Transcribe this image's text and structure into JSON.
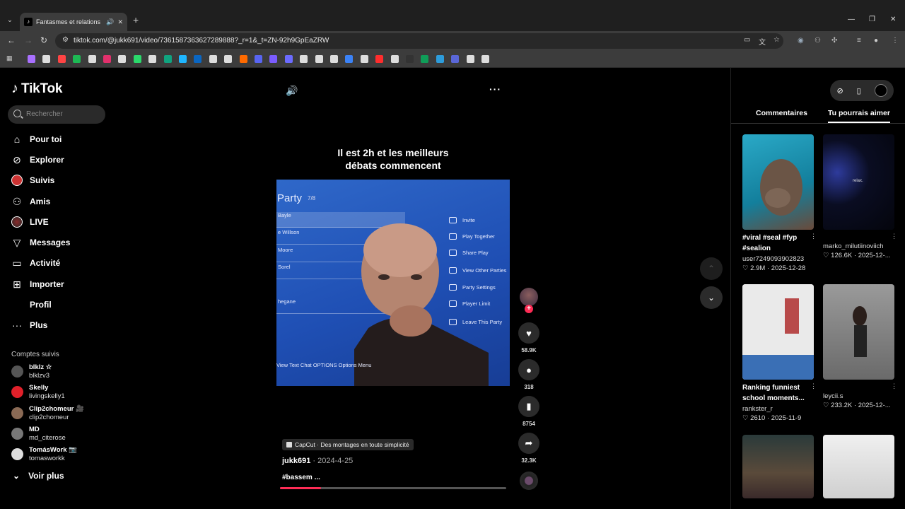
{
  "browser": {
    "tab_title": "Fantasmes et relations : oser",
    "tab_audio_icon": "speaker-icon",
    "url": "tiktok.com/@jukk691/video/7361587363627289888?_r=1&_t=ZN-92h9GpEaZRW"
  },
  "bookmarks_colors": [
    "#a970ff",
    "#ddd",
    "#ff4444",
    "#1db954",
    "#ddd",
    "#e1306c",
    "#ddd",
    "#2bd96b",
    "#ddd",
    "#10a37f",
    "#1fb6ff",
    "#0a66c2",
    "#ddd",
    "#ddd",
    "#ff6a00",
    "#5865f2",
    "#7b5cff",
    "#6b6bff",
    "#ddd",
    "#ddd",
    "#ddd",
    "#3b82f6",
    "#ddd",
    "#ff2d2d",
    "#ddd",
    "#333",
    "#0f9d58",
    "#2d9cdb",
    "#5a67d8",
    "#ddd",
    "#ddd"
  ],
  "sidebar": {
    "logo": "TikTok",
    "search_placeholder": "Rechercher",
    "nav": [
      {
        "label": "Pour toi",
        "icon": "home-icon"
      },
      {
        "label": "Explorer",
        "icon": "compass-icon"
      },
      {
        "label": "Suivis",
        "icon": "following-icon"
      },
      {
        "label": "Amis",
        "icon": "friends-icon"
      },
      {
        "label": "LIVE",
        "icon": "live-icon"
      },
      {
        "label": "Messages",
        "icon": "messages-icon"
      },
      {
        "label": "Activité",
        "icon": "activity-icon"
      },
      {
        "label": "Importer",
        "icon": "upload-icon"
      },
      {
        "label": "Profil",
        "icon": "profile-icon"
      },
      {
        "label": "Plus",
        "icon": "more-icon"
      }
    ],
    "following_title": "Comptes suivis",
    "accounts": [
      {
        "name": "blklz ☆",
        "handle": "blklzv3",
        "color": "#555"
      },
      {
        "name": "Skelly",
        "handle": "livingskelly1",
        "color": "#e0202a"
      },
      {
        "name": "Clip2chomeur 🎥",
        "handle": "clip2chomeur",
        "color": "#8a6a55"
      },
      {
        "name": "MD",
        "handle": "md_citerose",
        "color": "#777"
      },
      {
        "name": "TomásWork 📷",
        "handle": "tomasworkk",
        "color": "#ddd"
      }
    ],
    "see_more": "Voir plus"
  },
  "video": {
    "caption_line1": "Il est 2h et les meilleurs",
    "caption_line2": "débats commencent",
    "party_title": "Party",
    "party_count": "7/8",
    "party_rows": [
      "Bayle",
      "e Willson",
      "Moore",
      "Sorel",
      "hegane",
      ""
    ],
    "party_menu": [
      "Invite",
      "Play Together",
      "Share Play",
      "View Other Parties",
      "Party Settings",
      "Player Limit",
      "Leave This Party"
    ],
    "footer": "View Text Chat      OPTIONS  Options Menu",
    "likes": "58.9K",
    "comments": "318",
    "saves": "8754",
    "shares": "32.3K",
    "capcut": "CapCut · Des montages en toute simplicité",
    "author": "jukk691",
    "date": " · 2024-4-25",
    "description": "#bassem ...",
    "progress": 0.18
  },
  "right_panel": {
    "tab_comments": "Commentaires",
    "tab_suggested": "Tu pourrais aimer",
    "cards": [
      {
        "title": "#viral #seal #fyp #sealion",
        "user": "user7249093902823",
        "stats": "♡ 2.9M · 2025-12-28"
      },
      {
        "title": "",
        "user": "marko_milutiinoviich",
        "stats": "♡ 126.6K · 2025-12-..."
      },
      {
        "title": "Ranking funniest school moments...",
        "user": "rankster_r",
        "stats": "♡ 2610 · 2025-11-9"
      },
      {
        "title": "",
        "user": "leycii.s",
        "stats": "♡ 233.2K · 2025-12-..."
      },
      {
        "title": "",
        "user": "",
        "stats": ""
      },
      {
        "title": "",
        "user": "",
        "stats": ""
      }
    ]
  }
}
